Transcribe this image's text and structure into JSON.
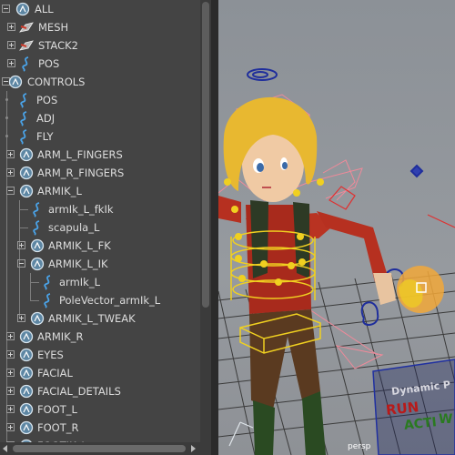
{
  "outliner": {
    "rows": [
      {
        "label": "ALL",
        "icon": "transform-icon"
      },
      {
        "label": "MESH",
        "icon": "mesh-group-icon"
      },
      {
        "label": "STACK2",
        "icon": "mesh-group-icon"
      },
      {
        "label": "POS",
        "icon": "curve-icon"
      },
      {
        "label": "CONTROLS",
        "icon": "transform-icon"
      },
      {
        "label": "POS",
        "icon": "curve-icon"
      },
      {
        "label": "ADJ",
        "icon": "curve-icon"
      },
      {
        "label": "FLY",
        "icon": "curve-icon"
      },
      {
        "label": "ARM_L_FINGERS",
        "icon": "transform-icon"
      },
      {
        "label": "ARM_R_FINGERS",
        "icon": "transform-icon"
      },
      {
        "label": "ARMIK_L",
        "icon": "transform-icon"
      },
      {
        "label": "armIk_L_fkIk",
        "icon": "curve-icon"
      },
      {
        "label": "scapula_L",
        "icon": "curve-icon"
      },
      {
        "label": "ARMIK_L_FK",
        "icon": "transform-icon"
      },
      {
        "label": "ARMIK_L_IK",
        "icon": "transform-icon"
      },
      {
        "label": "armIk_L",
        "icon": "curve-icon"
      },
      {
        "label": "PoleVector_armIk_L",
        "icon": "curve-icon"
      },
      {
        "label": "ARMIK_L_TWEAK",
        "icon": "transform-icon"
      },
      {
        "label": "ARMIK_R",
        "icon": "transform-icon"
      },
      {
        "label": "EYES",
        "icon": "transform-icon"
      },
      {
        "label": "FACIAL",
        "icon": "transform-icon"
      },
      {
        "label": "FACIAL_DETAILS",
        "icon": "transform-icon"
      },
      {
        "label": "FOOT_L",
        "icon": "transform-icon"
      },
      {
        "label": "FOOT_R",
        "icon": "transform-icon"
      },
      {
        "label": "FOOTIK_L",
        "icon": "transform-icon"
      }
    ]
  },
  "viewport": {
    "camera_label": "persp",
    "sign_title": "Dynamic P",
    "sign_run": "RUN",
    "sign_action": "ACTI",
    "sign_w": "W"
  },
  "colors": {
    "panel_bg": "#444444",
    "text": "#dcdcdc",
    "control_yellow": "#f0d020",
    "control_red": "#e03030",
    "control_blue": "#2030a0",
    "grid": "#303030"
  }
}
